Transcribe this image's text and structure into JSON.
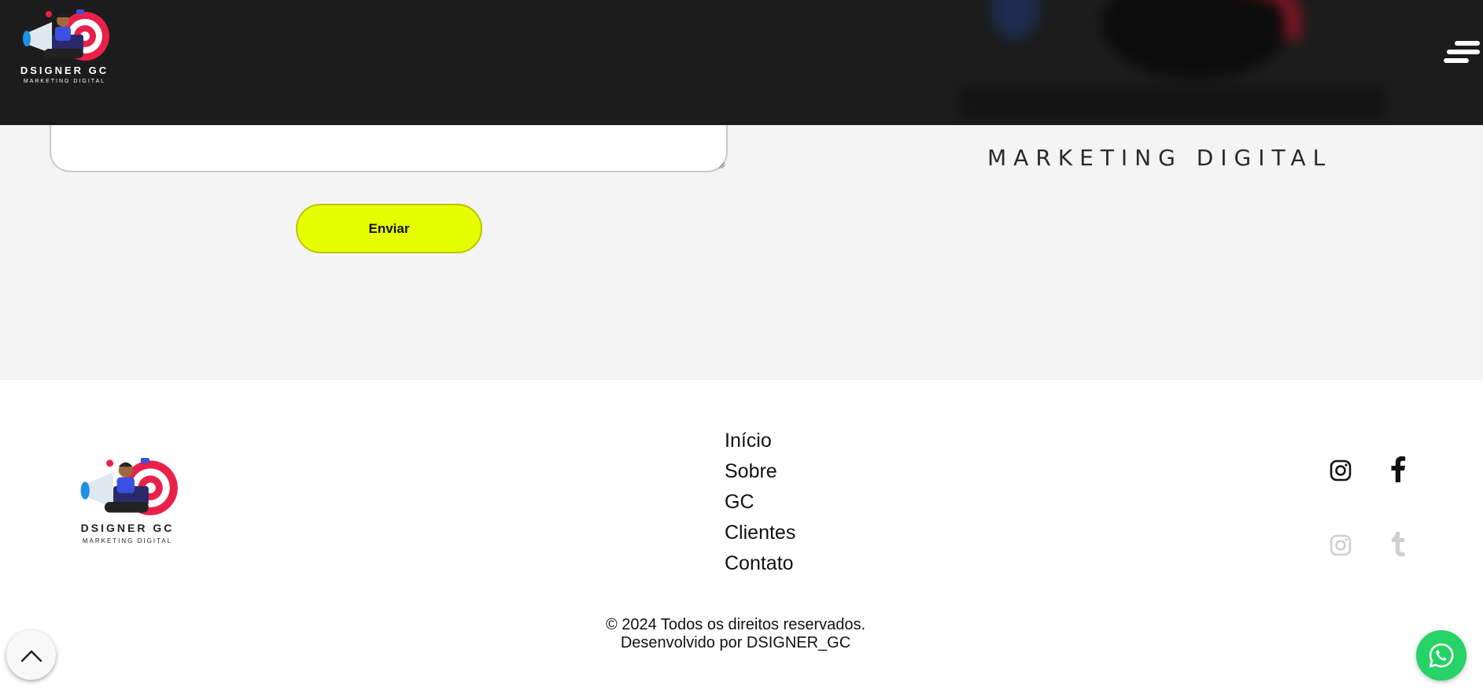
{
  "header": {
    "logo_word": "DSIGNER GC",
    "logo_sub": "MARKETING DIGITAL",
    "menu_icon": "hamburger-menu-icon"
  },
  "contact": {
    "message_value": "",
    "send_label": "Enviar",
    "brand_tagline": "MARKETING DIGITAL"
  },
  "footer": {
    "logo_word": "DSIGNER GC",
    "logo_sub": "MARKETING DIGITAL",
    "nav": [
      "Início",
      "Sobre",
      "GC",
      "Clientes",
      "Contato"
    ],
    "social": [
      {
        "icon": "instagram-icon",
        "color": "#111111"
      },
      {
        "icon": "facebook-icon",
        "color": "#111111"
      },
      {
        "icon": "instagram-icon",
        "color": "#cfcfcf"
      },
      {
        "icon": "tumblr-icon",
        "color": "#cfcfcf"
      }
    ],
    "copyright_line1": "© 2024 Todos os direitos reservados.",
    "copyright_line2": "Desenvolvido por DSIGNER_GC"
  },
  "floating": {
    "back_to_top_icon": "chevron-up-icon",
    "whatsapp_icon": "whatsapp-icon",
    "whatsapp_color": "#25d366",
    "accent_color": "#e6ff00"
  }
}
